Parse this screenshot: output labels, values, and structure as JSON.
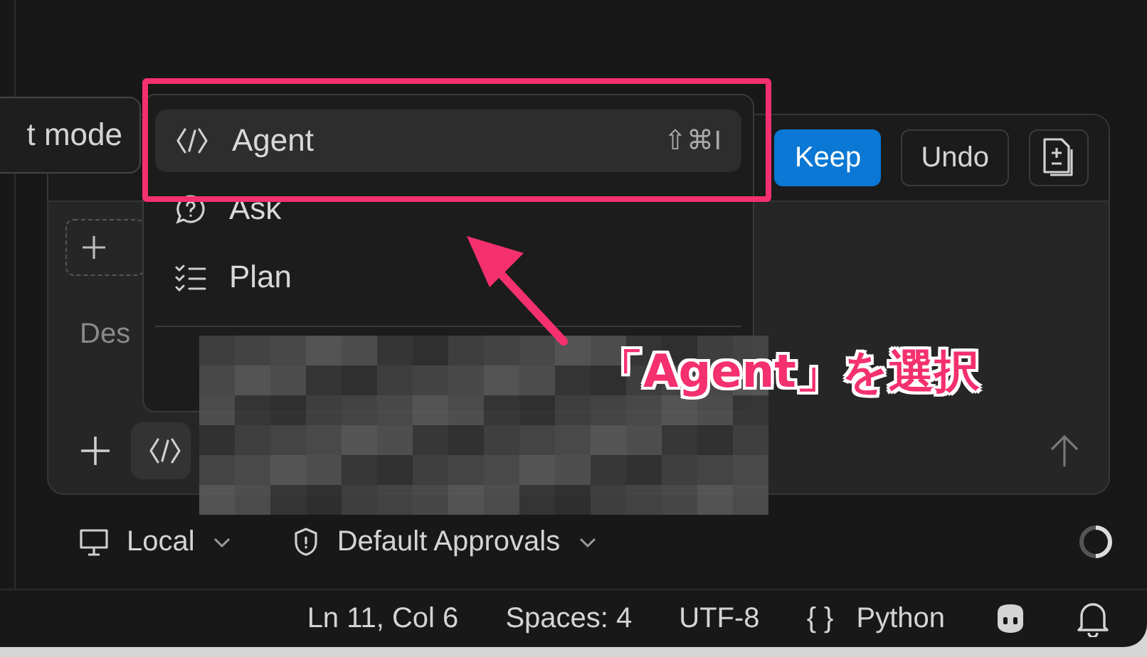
{
  "tooltip": {
    "text": "t mode"
  },
  "panel": {
    "buttons": [
      {
        "label": "Keep",
        "kind": "primary"
      },
      {
        "label": "Undo",
        "kind": "secondary"
      }
    ],
    "input": {
      "placeholder": "Des"
    }
  },
  "mode_menu": {
    "items": [
      {
        "label": "Agent",
        "shortcut": "⇧⌘I",
        "selected": true,
        "kind": "agent"
      },
      {
        "label": "Ask",
        "selected": false,
        "kind": "ask"
      },
      {
        "label": "Plan",
        "selected": false,
        "kind": "plan"
      }
    ]
  },
  "toolbar": {
    "items": [
      {
        "label": "Local",
        "kind": "monitor"
      },
      {
        "label": "Default Approvals",
        "kind": "shield"
      }
    ]
  },
  "status_bar": {
    "items": [
      "Ln 11, Col 6",
      "Spaces: 4",
      "UTF-8"
    ],
    "language": {
      "icon": "{ }",
      "label": "Python"
    }
  },
  "annotation": {
    "text": "「Agent」を選択"
  }
}
